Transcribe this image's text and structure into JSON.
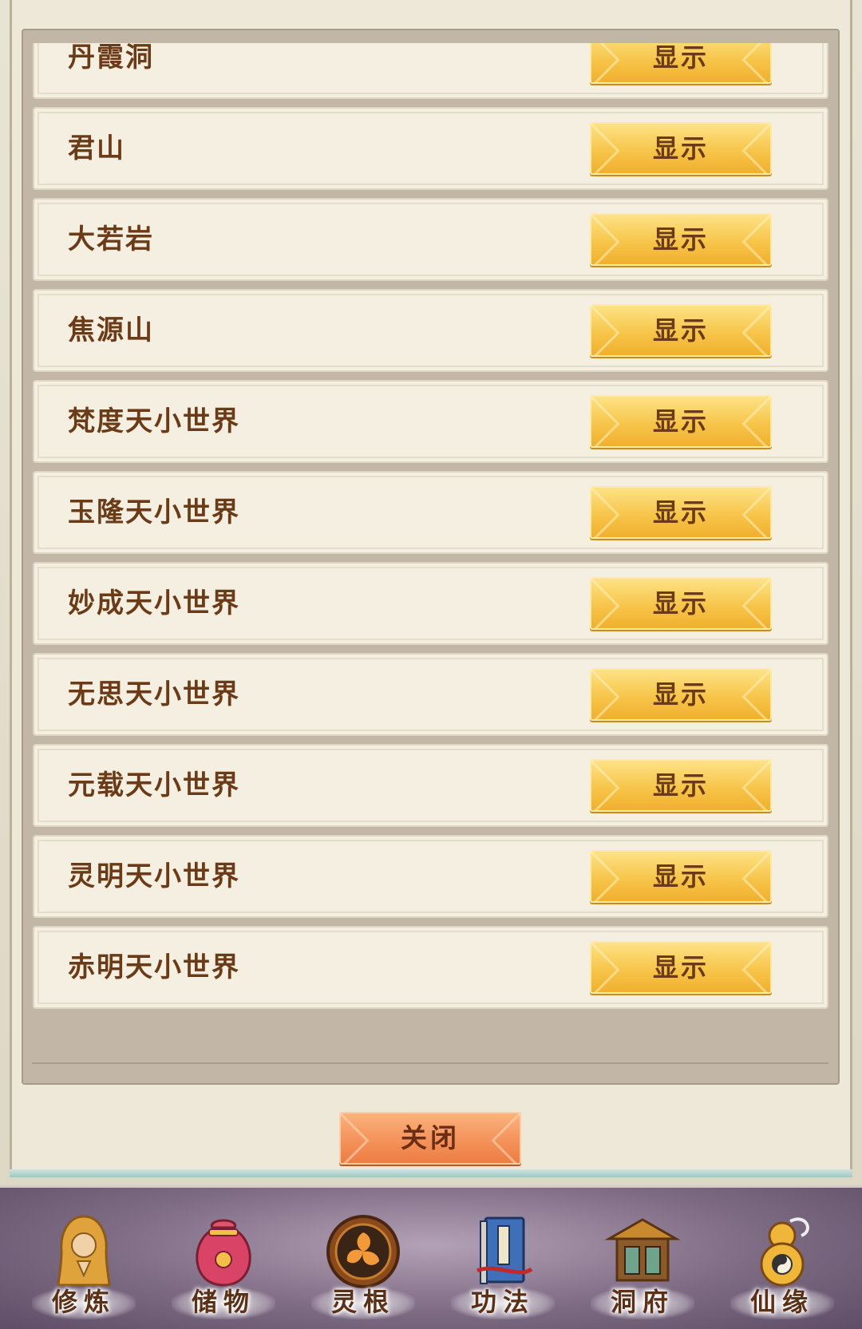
{
  "list": {
    "items": [
      {
        "name": "丹霞洞",
        "button": "显示"
      },
      {
        "name": "君山",
        "button": "显示"
      },
      {
        "name": "大若岩",
        "button": "显示"
      },
      {
        "name": "焦源山",
        "button": "显示"
      },
      {
        "name": "梵度天小世界",
        "button": "显示"
      },
      {
        "name": "玉隆天小世界",
        "button": "显示"
      },
      {
        "name": "妙成天小世界",
        "button": "显示"
      },
      {
        "name": "无思天小世界",
        "button": "显示"
      },
      {
        "name": "元载天小世界",
        "button": "显示"
      },
      {
        "name": "灵明天小世界",
        "button": "显示"
      },
      {
        "name": "赤明天小世界",
        "button": "显示"
      }
    ]
  },
  "close_label": "关闭",
  "nav": {
    "items": [
      {
        "label": "修炼",
        "icon": "cultivation-icon"
      },
      {
        "label": "储物",
        "icon": "storage-bag-icon"
      },
      {
        "label": "灵根",
        "icon": "spirit-root-icon"
      },
      {
        "label": "功法",
        "icon": "technique-book-icon"
      },
      {
        "label": "洞府",
        "icon": "cave-dwelling-icon"
      },
      {
        "label": "仙缘",
        "icon": "gourd-icon"
      }
    ]
  },
  "colors": {
    "text_brown": "#6b3a17",
    "button_gold": "#f7c54a",
    "close_orange": "#f4925a",
    "row_bg": "#f4efe1",
    "nav_bg": "#7d6a83"
  }
}
